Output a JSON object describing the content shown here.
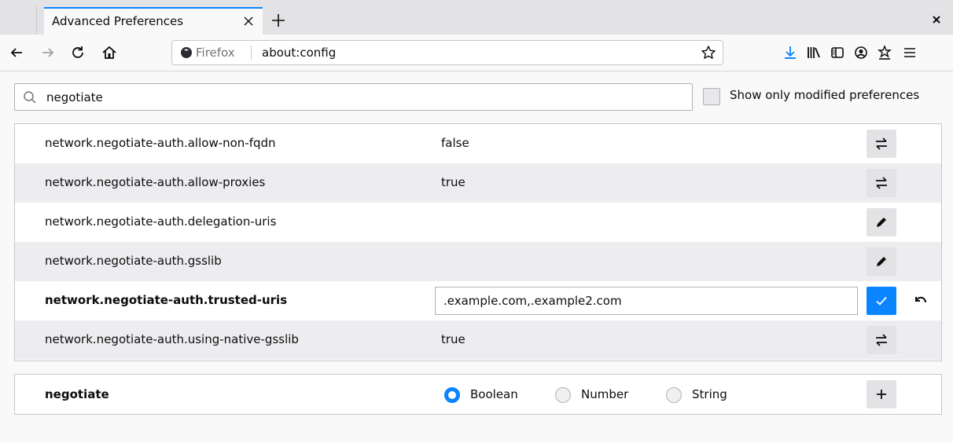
{
  "tab": {
    "title": "Advanced Preferences"
  },
  "urlbar": {
    "identity": "Firefox",
    "url": "about:config"
  },
  "search": {
    "value": "negotiate"
  },
  "filter": {
    "label": "Show only modified preferences",
    "checked": false
  },
  "prefs": [
    {
      "name": "network.negotiate-auth.allow-non-fqdn",
      "value": "false",
      "action": "toggle"
    },
    {
      "name": "network.negotiate-auth.allow-proxies",
      "value": "true",
      "action": "toggle"
    },
    {
      "name": "network.negotiate-auth.delegation-uris",
      "value": "",
      "action": "edit"
    },
    {
      "name": "network.negotiate-auth.gsslib",
      "value": "",
      "action": "edit"
    },
    {
      "name": "network.negotiate-auth.trusted-uris",
      "value": ".example.com,.example2.com",
      "action": "save",
      "modified": true,
      "editing": true
    },
    {
      "name": "network.negotiate-auth.using-native-gsslib",
      "value": "true",
      "action": "toggle"
    }
  ],
  "add": {
    "name": "negotiate",
    "types": [
      {
        "label": "Boolean",
        "selected": true
      },
      {
        "label": "Number",
        "selected": false
      },
      {
        "label": "String",
        "selected": false
      }
    ]
  },
  "colors": {
    "accent": "#0a84ff",
    "row_alt": "#ededf0"
  }
}
